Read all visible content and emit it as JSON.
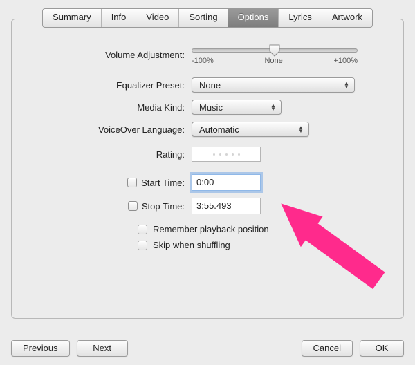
{
  "tabs": {
    "summary": "Summary",
    "info": "Info",
    "video": "Video",
    "sorting": "Sorting",
    "options": "Options",
    "lyrics": "Lyrics",
    "artwork": "Artwork",
    "selected": "options"
  },
  "options": {
    "volume_label": "Volume Adjustment:",
    "volume_ticks": {
      "min": "-100%",
      "mid": "None",
      "max": "+100%"
    },
    "eq_label": "Equalizer Preset:",
    "eq_value": "None",
    "media_label": "Media Kind:",
    "media_value": "Music",
    "voiceover_label": "VoiceOver Language:",
    "voiceover_value": "Automatic",
    "rating_label": "Rating:",
    "start_label": "Start Time:",
    "start_value": "0:00",
    "stop_label": "Stop Time:",
    "stop_value": "3:55.493",
    "remember_label": "Remember playback position",
    "skip_label": "Skip when shuffling"
  },
  "buttons": {
    "previous": "Previous",
    "next": "Next",
    "cancel": "Cancel",
    "ok": "OK"
  }
}
